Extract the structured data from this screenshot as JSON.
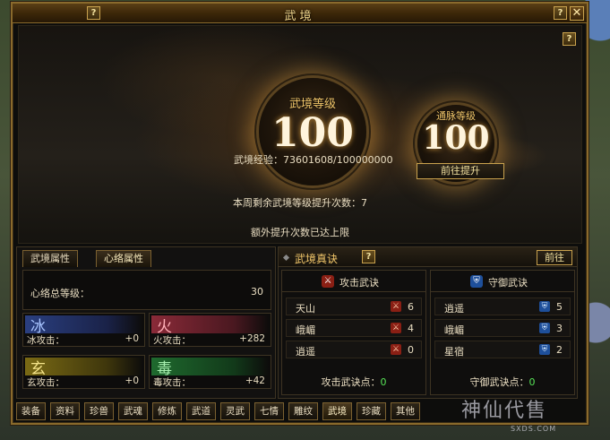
{
  "window": {
    "title": "武境"
  },
  "hero": {
    "wujing_level_label": "武境等级",
    "wujing_level_value": "100",
    "tongmai_level_label": "通脉等级",
    "tongmai_level_value": "100",
    "exp_label": "武境经验：",
    "exp_value": "73601608/100000000",
    "goto_upgrade": "前往提升",
    "weekly_remaining": "本周剩余武境等级提升次数：7",
    "extra_limit": "额外提升次数已达上限"
  },
  "left_panel": {
    "tabs": [
      "武境属性",
      "心络属性"
    ],
    "total_label": "心络总等级：",
    "total_value": "30",
    "elements": [
      {
        "char": "冰",
        "label": "冰攻击：",
        "value": "+0",
        "color": "#3f5fb0"
      },
      {
        "char": "火",
        "label": "火攻击：",
        "value": "+282",
        "color": "#b03848"
      },
      {
        "char": "玄",
        "label": "玄攻击：",
        "value": "+0",
        "color": "#9a8a20"
      },
      {
        "char": "毒",
        "label": "毒攻击：",
        "value": "+42",
        "color": "#2a8a3c"
      }
    ]
  },
  "right_panel": {
    "title": "武境真诀",
    "go_label": "前往",
    "attack": {
      "title": "攻击武诀",
      "rows": [
        {
          "name": "天山",
          "value": "6"
        },
        {
          "name": "峨嵋",
          "value": "4"
        },
        {
          "name": "逍遥",
          "value": "0"
        }
      ],
      "points_label": "攻击武诀点：",
      "points_value": "0"
    },
    "defense": {
      "title": "守御武诀",
      "rows": [
        {
          "name": "逍遥",
          "value": "5"
        },
        {
          "name": "峨嵋",
          "value": "3"
        },
        {
          "name": "星宿",
          "value": "2"
        }
      ],
      "points_label": "守御武诀点：",
      "points_value": "0"
    }
  },
  "bottom_tabs": [
    "装备",
    "资料",
    "珍兽",
    "武魂",
    "修炼",
    "武道",
    "灵武",
    "七情",
    "雕纹",
    "武境",
    "珍藏",
    "其他"
  ],
  "active_bottom_tab": "武境",
  "watermark": {
    "main": "神仙代售",
    "sub": "SXDS.COM"
  },
  "help_glyph": "?",
  "close_glyph": "✕"
}
